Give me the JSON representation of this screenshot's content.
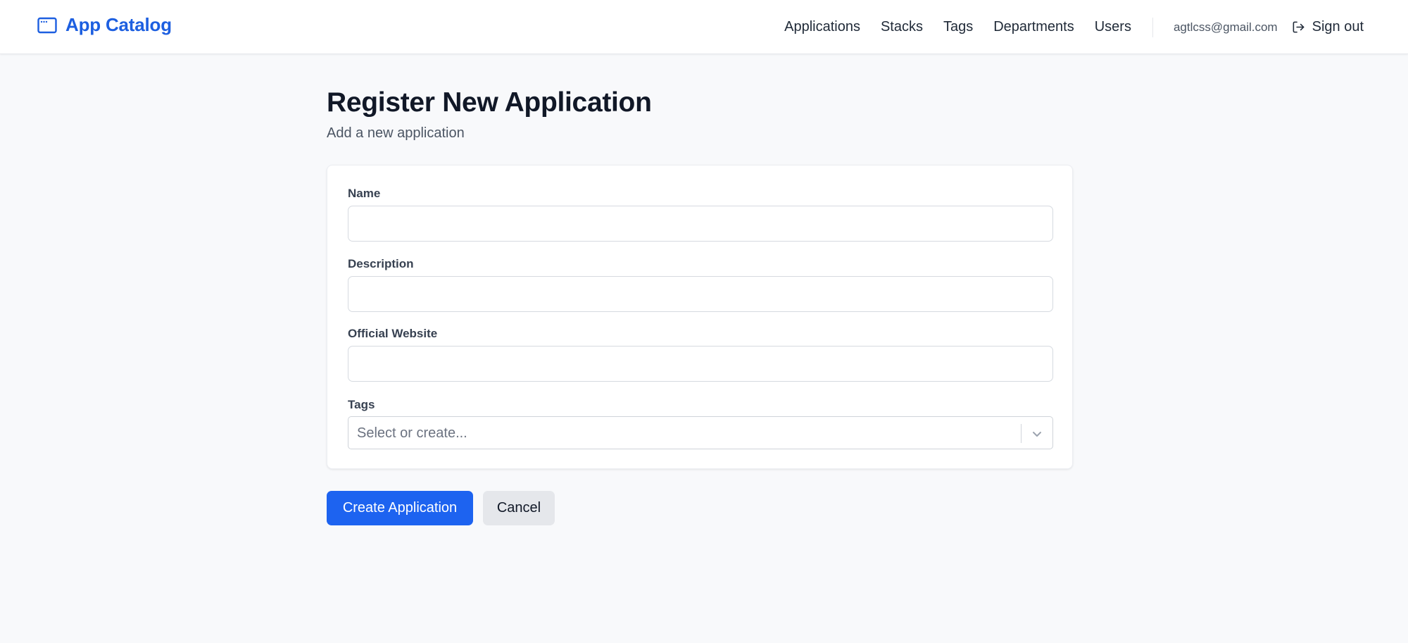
{
  "header": {
    "brand_title": "App Catalog",
    "brand_icon": "app-window-icon",
    "nav": [
      "Applications",
      "Stacks",
      "Tags",
      "Departments",
      "Users"
    ],
    "user_email": "agtlcss@gmail.com",
    "sign_out_label": "Sign out",
    "sign_out_icon": "sign-out-icon"
  },
  "page": {
    "title": "Register New Application",
    "subtitle": "Add a new application"
  },
  "form": {
    "name": {
      "label": "Name",
      "value": "",
      "placeholder": ""
    },
    "description": {
      "label": "Description",
      "value": "",
      "placeholder": ""
    },
    "website": {
      "label": "Official Website",
      "value": "",
      "placeholder": ""
    },
    "tags": {
      "label": "Tags",
      "placeholder": "Select or create..."
    }
  },
  "actions": {
    "create_label": "Create Application",
    "cancel_label": "Cancel"
  },
  "colors": {
    "accent": "#1d63f0",
    "brand": "#1d5fe0",
    "background": "#f8f9fb"
  }
}
